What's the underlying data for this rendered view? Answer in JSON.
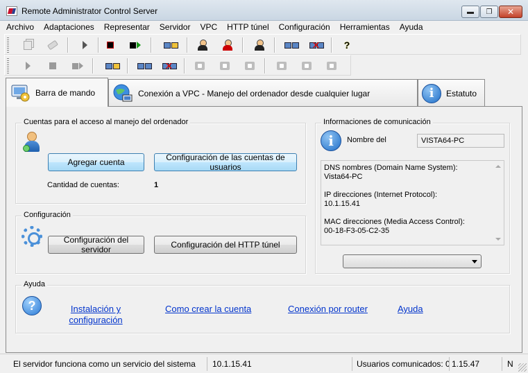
{
  "window": {
    "title": "Remote Administrator Control Server",
    "controls": {
      "minimize": "▬",
      "maximize": "❐",
      "close": "✕"
    }
  },
  "menu": [
    "Archivo",
    "Adaptaciones",
    "Representar",
    "Servidor",
    "VPC",
    "HTTP túnel",
    "Configuración",
    "Herramientas",
    "Ayuda"
  ],
  "toolbar1": {
    "icons": [
      "copy-icon",
      "eraser-icon",
      "play-icon",
      "stop-icon",
      "stop-play-icon",
      "computers-connect-icon",
      "user-icon",
      "user-remove-icon",
      "computers-user-icon",
      "computers-user-add-icon",
      "computers-disconnect-icon",
      "help-icon"
    ],
    "help_glyph": "?"
  },
  "toolbar2": {
    "icons": [
      "play-icon",
      "stop-icon",
      "stop-play-icon",
      "computers-connect-icon",
      "computers-user-icon",
      "computers-disconnect-icon",
      "grey-action-icon"
    ]
  },
  "tabs": [
    {
      "label": "Barra de mando",
      "icon": "computer-gear-icon",
      "selected": true
    },
    {
      "label": "Conexión a VPC - Manejo del ordenador desde cualquier lugar",
      "icon": "globe-computer-icon",
      "selected": false
    },
    {
      "label": "Estatuto",
      "icon": "info-icon",
      "selected": false
    }
  ],
  "cuentas": {
    "title": "Cuentas para el acceso al manejo del ordenador",
    "add_button": "Agregar cuenta",
    "config_button": "Configuración de las cuentas de usuarios",
    "count_label": "Cantidad de cuentas:",
    "count_value": "1"
  },
  "configuracion": {
    "title": "Configuración",
    "server_button": "Configuración del servidor",
    "http_button": "Configuración del HTTP túnel"
  },
  "info": {
    "title": "Informaciones de comunicación",
    "name_label": "Nombre del",
    "name_value": "VISTA64-PC",
    "lines": [
      "DNS nombres (Domain Name System):",
      "Vista64-PC",
      "",
      "IP direcciones (Internet Protocol):",
      "10.1.15.41",
      "",
      "MAC direcciones (Media Access Control):",
      "00-18-F3-05-C2-35"
    ],
    "info_glyph": "i"
  },
  "ayuda": {
    "title": "Ayuda",
    "links": [
      "Instalación y configuración",
      "Como crear la cuenta",
      "Conexión por router",
      "Ayuda"
    ],
    "q_glyph": "?"
  },
  "status": {
    "message": "El servidor funciona como un servicio del sistema",
    "ip": "10.1.15.41",
    "users": "Usuarios comunicados: 0",
    "version": "1.15.47",
    "extra": "N"
  },
  "colors": {
    "link": "#0033cc",
    "accent": "#1f6fc8",
    "hot_button": "#bee6fd"
  }
}
